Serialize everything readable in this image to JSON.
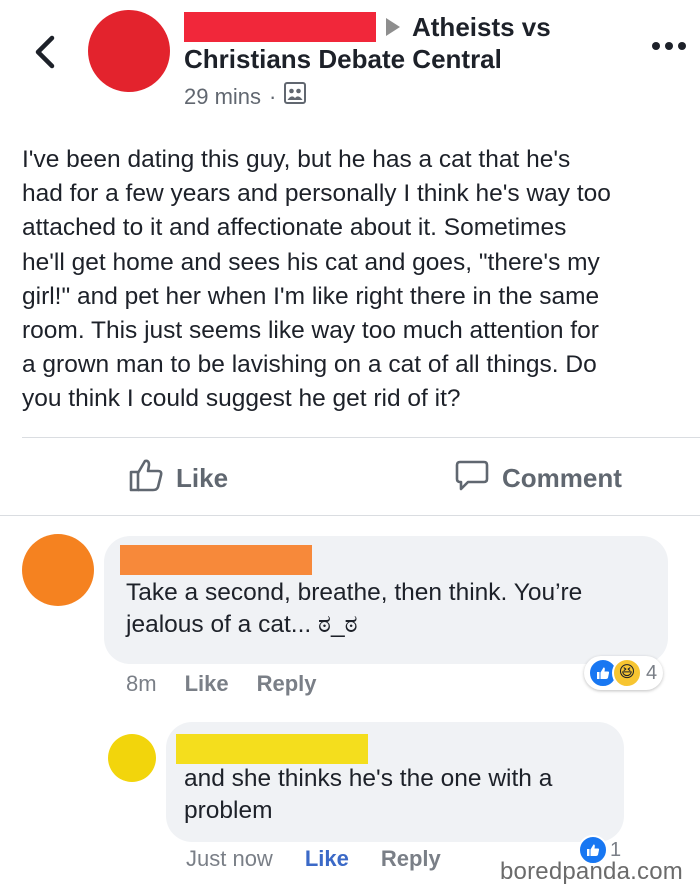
{
  "post": {
    "group_line1": "Atheists vs",
    "group_line2": "Christians Debate Central",
    "time": "29 mins",
    "privacy_icon": "group-icon",
    "body_lines": [
      "I've been dating this guy, but he has a cat that he's",
      "had for a few years and personally I think he's way too",
      "attached to it and affectionate about it. Sometimes",
      "he'll get home and sees his cat and goes, \"there's my",
      "girl!\" and pet her when I'm like right there in the same",
      "room. This just seems like way too much attention for",
      "a grown man to be lavishing on a cat of all things. Do",
      "you think I could suggest he get rid of it?"
    ]
  },
  "actions": {
    "like_label": "Like",
    "comment_label": "Comment"
  },
  "comments": [
    {
      "avatar_color": "#f58220",
      "redaction_color": "#f7893a",
      "text_line1": "Take a second, breathe, then think. You’re",
      "text_line2": "jealous of a cat... ಠ_ಠ",
      "time": "8m",
      "like_label": "Like",
      "reply_label": "Reply",
      "reaction_icons": [
        "like-icon",
        "haha-icon"
      ],
      "reaction_count": "4"
    },
    {
      "avatar_color": "#f2d50c",
      "redaction_color": "#f4de1d",
      "text_line1": "and she thinks he's the one with a",
      "text_line2": "problem",
      "time": "Just now",
      "like_label": "Like",
      "reply_label": "Reply",
      "reaction_icons": [
        "like-icon"
      ],
      "reaction_count": "1"
    }
  ],
  "watermark": "boredpanda.com",
  "colors": {
    "poster_avatar": "#e3232d",
    "poster_redaction": "#f1273a",
    "like_blue": "#1877f2"
  }
}
